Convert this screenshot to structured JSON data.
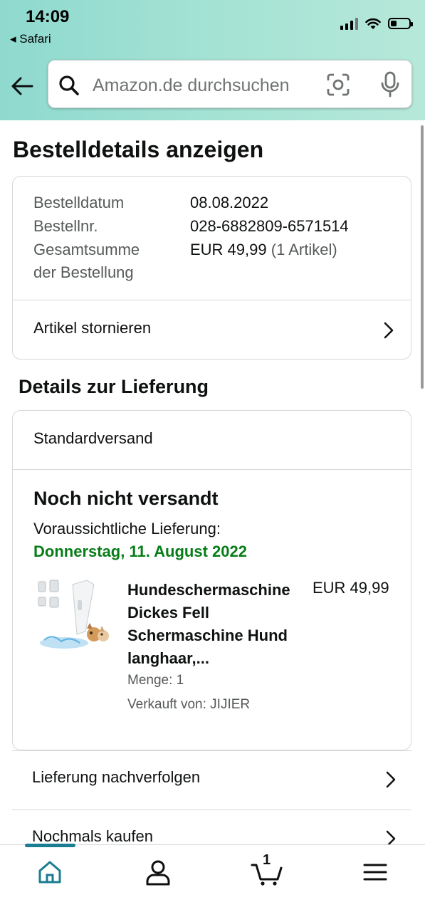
{
  "status_bar": {
    "time": "14:09",
    "back_app": "◂ Safari",
    "battery_level": 0.35
  },
  "search": {
    "placeholder": "Amazon.de durchsuchen"
  },
  "page": {
    "title": "Bestelldetails anzeigen"
  },
  "order": {
    "date_label": "Bestelldatum",
    "date_value": "08.08.2022",
    "number_label": "Bestellnr.",
    "number_value": "028-6882809-6571514",
    "total_label_line1": "Gesamtsumme",
    "total_label_line2": "der Bestellung",
    "total_value": "EUR 49,99",
    "total_items": "(1 Artikel)",
    "cancel_label": "Artikel stornieren"
  },
  "delivery": {
    "section_title": "Details zur Lieferung",
    "shipping_method": "Standardversand",
    "status": "Noch nicht versandt",
    "eta_label": "Voraussichtliche Lieferung:",
    "eta_date": "Donnerstag, 11. August 2022",
    "eta_color": "#067d17"
  },
  "product": {
    "name_lines": [
      "Hundeschermaschine",
      "Dickes Fell",
      "Schermaschine Hund",
      "langhaar,..."
    ],
    "price": "EUR 49,99",
    "quantity": "Menge: 1",
    "seller": "Verkauft von: JIJIER"
  },
  "actions": {
    "track": "Lieferung nachverfolgen",
    "buy_again": "Nochmals kaufen"
  },
  "bottom_nav": {
    "items": [
      "home-icon",
      "account-icon",
      "cart-icon",
      "menu-icon"
    ],
    "cart_count": "1",
    "active_color": "#1a7d91"
  }
}
